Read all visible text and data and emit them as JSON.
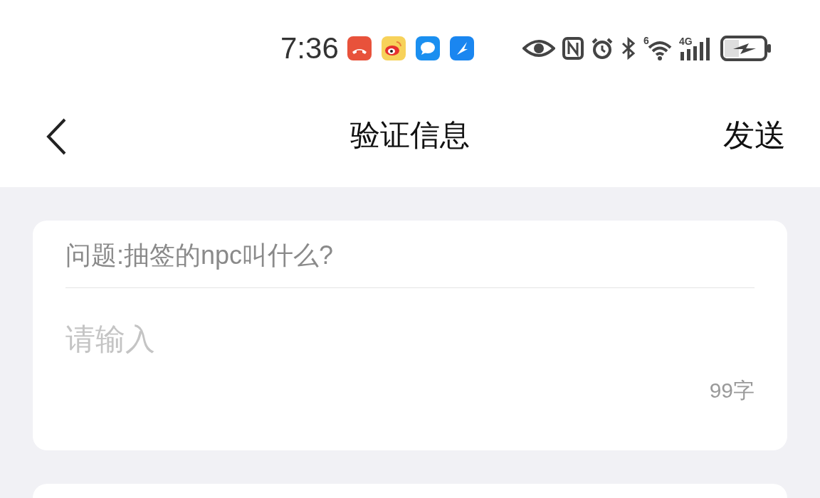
{
  "status_bar": {
    "time": "7:36",
    "wifi_label": "6",
    "cell_label": "4G"
  },
  "header": {
    "title": "验证信息",
    "action": "发送"
  },
  "question_card": {
    "question": "问题:抽签的npc叫什么?",
    "answer": {
      "placeholder": "请输入"
    },
    "counter": "99字"
  }
}
